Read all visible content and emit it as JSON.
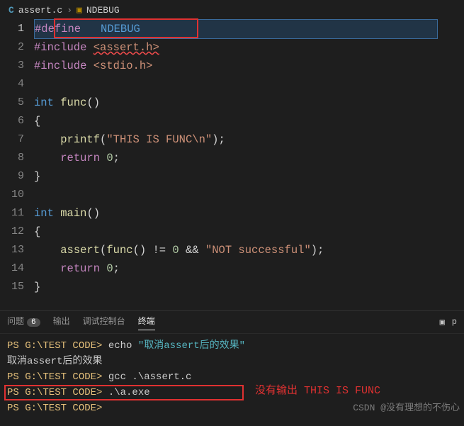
{
  "breadcrumb": {
    "icon": "C",
    "file": "assert.c",
    "symbol": "NDEBUG"
  },
  "gutter": {
    "lines": [
      "1",
      "2",
      "3",
      "4",
      "5",
      "6",
      "7",
      "8",
      "9",
      "10",
      "11",
      "12",
      "13",
      "14",
      "15"
    ]
  },
  "code": {
    "l1_define": "#define",
    "l1_sym": "NDEBUG",
    "l2_include": "#include",
    "l2_hdr": "<assert.h>",
    "l3_include": "#include",
    "l3_hdr": "<stdio.h>",
    "l5_type": "int",
    "l5_fn": "func",
    "l5_paren": "()",
    "l6_brace": "{",
    "l7_fn": "printf",
    "l7_open": "(",
    "l7_str": "\"THIS IS FUNC\\n\"",
    "l7_close": ");",
    "l8_ret": "return",
    "l8_val": "0",
    "l8_semi": ";",
    "l9_brace": "}",
    "l11_type": "int",
    "l11_fn": "main",
    "l11_paren": "()",
    "l12_brace": "{",
    "l13_fn": "assert",
    "l13_open": "(",
    "l13_call": "func",
    "l13_call_paren": "()",
    "l13_op1": " != ",
    "l13_zero": "0",
    "l13_op2": " && ",
    "l13_str": "\"NOT successful\"",
    "l13_close": ");",
    "l14_ret": "return",
    "l14_val": "0",
    "l14_semi": ";",
    "l15_brace": "}"
  },
  "panel": {
    "tabs": {
      "problems": "问题",
      "problems_count": "6",
      "output": "输出",
      "debug": "调试控制台",
      "terminal": "终端"
    },
    "action_label": "p"
  },
  "terminal": {
    "prompt": "PS G:\\TEST CODE>",
    "line1_cmd": "echo",
    "line1_arg": "\"取消assert后的效果\"",
    "line2": "取消assert后的效果",
    "line3_cmd": "gcc .\\assert.c",
    "line4_cmd": ".\\a.exe",
    "line5_cmd": ""
  },
  "annotation": "没有输出 THIS IS FUNC",
  "watermark": "CSDN @没有理想的不伤心"
}
